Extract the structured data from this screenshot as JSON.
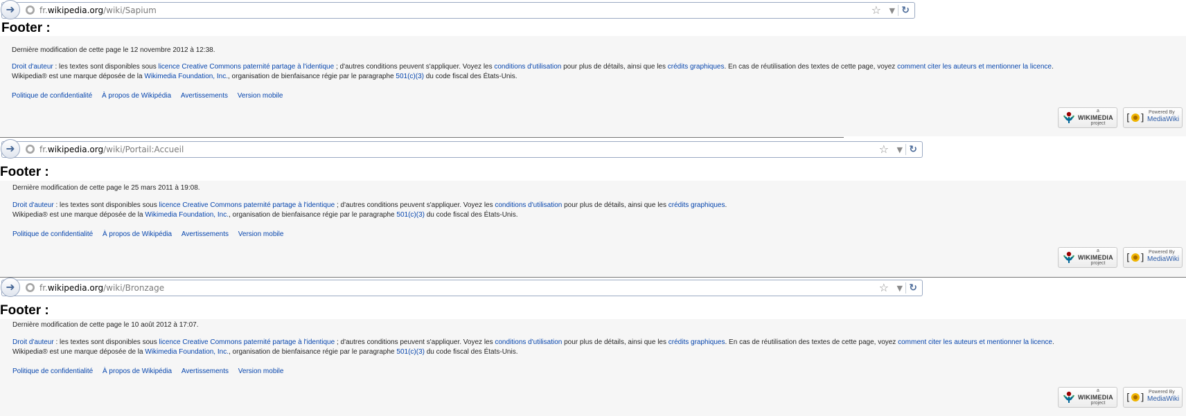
{
  "panels": [
    {
      "url_domain_pre": "fr.",
      "url_domain": "wikipedia.org",
      "url_path": "/wiki/Sapium",
      "heading": "Footer :",
      "lastmod": "Dernière modification de cette page le 12 novembre 2012 à 12:38.",
      "license": {
        "copyright_link": "Droit d'auteur",
        "t1": " : les textes sont disponibles sous ",
        "cc_link": "licence Creative Commons paternité partage à l'identique",
        "t2": " ; d'autres conditions peuvent s'appliquer. Voyez les ",
        "terms_link": "conditions d'utilisation",
        "t3": " pour plus de détails, ainsi que les ",
        "credits_link": "crédits graphiques",
        "t4": ". En cas de réutilisation des textes de cette page, voyez ",
        "cite_link": "comment citer les auteurs et mentionner la licence",
        "t5": "."
      },
      "trademark": {
        "t1": "Wikipedia® est une marque déposée de la ",
        "wmf_link": "Wikimedia Foundation, Inc.",
        "t2": ", organisation de bienfaisance régie par le paragraphe ",
        "c3_link": "501(c)(3)",
        "t3": " du code fiscal des États-Unis."
      },
      "links": [
        "Politique de confidentialité",
        "À propos de Wikipédia",
        "Avertissements",
        "Version mobile"
      ]
    },
    {
      "url_domain_pre": "fr.",
      "url_domain": "wikipedia.org",
      "url_path": "/wiki/Portail:Accueil",
      "heading": "Footer :",
      "lastmod": "Dernière modification de cette page le 25 mars 2011 à 19:08.",
      "license": {
        "copyright_link": "Droit d'auteur",
        "t1": " : les textes sont disponibles sous ",
        "cc_link": "licence Creative Commons paternité partage à l'identique",
        "t2": " ; d'autres conditions peuvent s'appliquer. Voyez les ",
        "terms_link": "conditions d'utilisation",
        "t3": " pour plus de détails, ainsi que les ",
        "credits_link": "crédits graphiques",
        "t4": ".",
        "cite_link": "",
        "t5": ""
      },
      "trademark": {
        "t1": "Wikipedia® est une marque déposée de la ",
        "wmf_link": "Wikimedia Foundation, Inc.",
        "t2": ", organisation de bienfaisance régie par le paragraphe ",
        "c3_link": "501(c)(3)",
        "t3": " du code fiscal des États-Unis."
      },
      "links": [
        "Politique de confidentialité",
        "À propos de Wikipédia",
        "Avertissements",
        "Version mobile"
      ]
    },
    {
      "url_domain_pre": "fr.",
      "url_domain": "wikipedia.org",
      "url_path": "/wiki/Bronzage",
      "heading": "Footer :",
      "lastmod": "Dernière modification de cette page le 10 août 2012 à 17:07.",
      "license": {
        "copyright_link": "Droit d'auteur",
        "t1": " : les textes sont disponibles sous ",
        "cc_link": "licence Creative Commons paternité partage à l'identique",
        "t2": " ; d'autres conditions peuvent s'appliquer. Voyez les ",
        "terms_link": "conditions d'utilisation",
        "t3": " pour plus de détails, ainsi que les ",
        "credits_link": "crédits graphiques",
        "t4": ". En cas de réutilisation des textes de cette page, voyez ",
        "cite_link": "comment citer les auteurs et mentionner la licence",
        "t5": "."
      },
      "trademark": {
        "t1": "Wikipedia® est une marque déposée de la ",
        "wmf_link": "Wikimedia Foundation, Inc.",
        "t2": ", organisation de bienfaisance régie par le paragraphe ",
        "c3_link": "501(c)(3)",
        "t3": " du code fiscal des États-Unis."
      },
      "links": [
        "Politique de confidentialité",
        "À propos de Wikipédia",
        "Avertissements",
        "Version mobile"
      ]
    }
  ],
  "badges": {
    "wikimedia_a": "a",
    "wikimedia_name": "WIKIMEDIA",
    "wikimedia_project": "project",
    "mediawiki_powered": "Powered By",
    "mediawiki_name": "MediaWiki"
  },
  "icons": {
    "back": "back-arrow-icon",
    "site": "globe-icon",
    "bookmark": "star-icon",
    "dropdown": "dropdown-arrow-icon",
    "reload": "reload-icon"
  },
  "colors": {
    "link": "#0645ad",
    "footer_bg": "#f6f6f6",
    "text": "#252525"
  }
}
